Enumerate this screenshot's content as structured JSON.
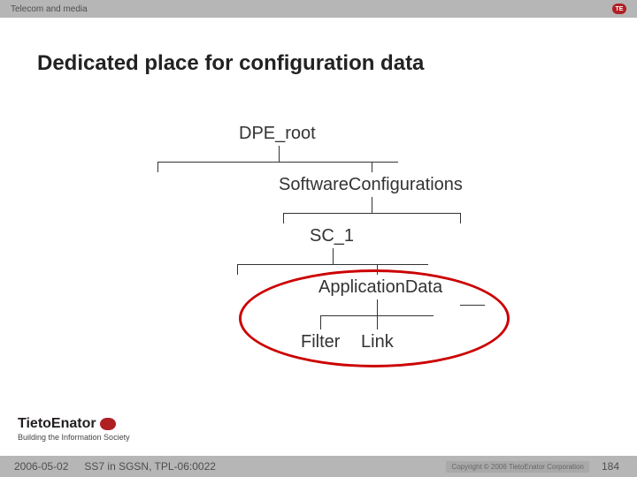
{
  "header": {
    "category": "Telecom and media"
  },
  "title": "Dedicated place for configuration data",
  "tree": {
    "root": "DPE_root",
    "level1": "SoftwareConfigurations",
    "level2": "SC_1",
    "level3": "ApplicationData",
    "leaf1": "Filter",
    "leaf2": "Link"
  },
  "brand": {
    "name": "TietoEnator",
    "tagline": "Building the Information Society"
  },
  "footer": {
    "date": "2006-05-02",
    "doc": "SS7 in SGSN, TPL-06:0022",
    "copyright": "Copyright © 2006 TietoEnator Corporation",
    "page": "184"
  }
}
